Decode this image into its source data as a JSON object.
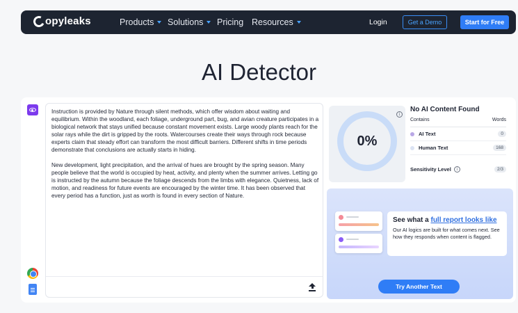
{
  "nav": {
    "logo_text": "opyleaks",
    "items": [
      {
        "label": "Products",
        "dropdown": true
      },
      {
        "label": "Solutions",
        "dropdown": true
      },
      {
        "label": "Pricing",
        "dropdown": false
      },
      {
        "label": "Resources",
        "dropdown": true
      }
    ],
    "login_label": "Login",
    "demo_label": "Get a Demo",
    "start_label": "Start for Free"
  },
  "page_title": "AI Detector",
  "editor": {
    "paragraphs": [
      "Instruction is provided by Nature through silent methods, which offer wisdom about waiting and equilibrium. Within the woodland, each foliage, underground part, bug, and avian creature participates in a biological network that stays unified because constant movement exists. Large woody plants reach for the solar rays while the dirt is gripped by the roots. Watercourses create their ways through rock because experts claim that steady effort can transform the most difficult barriers. Different shifts in time periods demonstrate that conclusions are actually starts in hiding.",
      "New development, light precipitation, and the arrival of hues are brought by the spring season. Many people believe that the world is occupied by heat, activity, and plenty when the summer arrives. Letting go is instructed by the autumn because the foliage descends from the limbs with elegance. Quietness, lack of motion, and readiness for future events are encouraged by the winter time. It has been observed that every period has a function, just as worth is found in every section of Nature."
    ]
  },
  "results": {
    "percentage": "0%",
    "title": "No AI Content Found",
    "contains_label": "Contains",
    "words_label": "Words",
    "rows": [
      {
        "label": "AI Text",
        "count": "0",
        "color": "#b9a7e6"
      },
      {
        "label": "Human Text",
        "count": "168",
        "color": "#dbe3f3"
      }
    ],
    "sensitivity_label": "Sensitivity Level",
    "sensitivity_value": "2/3"
  },
  "promo": {
    "heading_prefix": "See what a",
    "heading_link": "full report looks like",
    "body": "Our AI logics are built for what comes next. See how they responds when content is flagged.",
    "button_label": "Try Another Text"
  },
  "colors": {
    "nav_bg": "#1d2431",
    "accent": "#2f7df6",
    "purple": "#7c3aed"
  }
}
